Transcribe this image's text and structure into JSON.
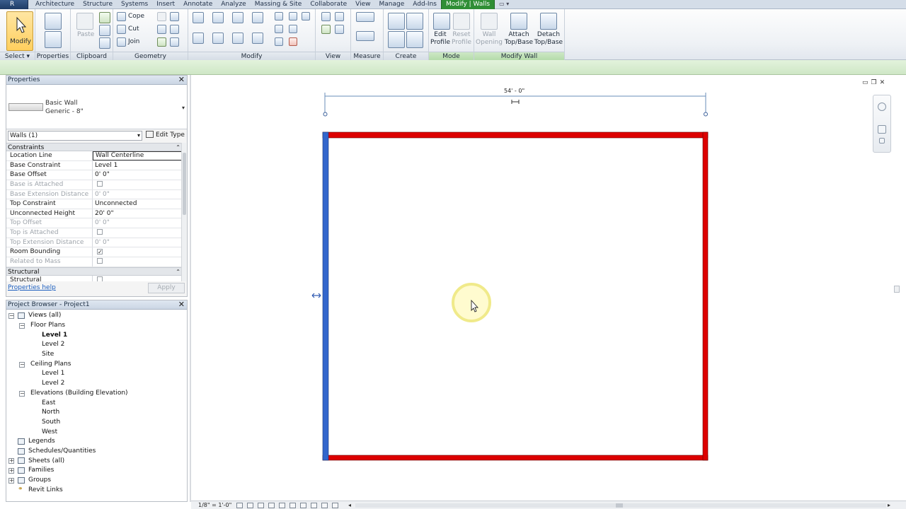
{
  "menu": {
    "app_button": "R",
    "tabs": [
      "Architecture",
      "Structure",
      "Systems",
      "Insert",
      "Annotate",
      "Analyze",
      "Massing & Site",
      "Collaborate",
      "View",
      "Manage",
      "Add-Ins",
      "Modify | Walls"
    ],
    "active_tab": "Modify | Walls",
    "extra": "▭ ▾"
  },
  "ribbon": {
    "select": {
      "button": "Modify",
      "label": "Select ▾"
    },
    "properties": {
      "label": "Properties"
    },
    "clipboard": {
      "paste": "Paste",
      "label": "Clipboard"
    },
    "geometry": {
      "cope": "Cope",
      "cut": "Cut",
      "join": "Join",
      "label": "Geometry"
    },
    "modify": {
      "label": "Modify"
    },
    "view": {
      "label": "View"
    },
    "measure": {
      "label": "Measure"
    },
    "create": {
      "label": "Create"
    },
    "mode": {
      "edit_profile_1": "Edit",
      "edit_profile_2": "Profile",
      "reset_profile_1": "Reset",
      "reset_profile_2": "Profile",
      "label": "Mode"
    },
    "modify_wall": {
      "wall_opening_1": "Wall",
      "wall_opening_2": "Opening",
      "attach_1": "Attach",
      "attach_2": "Top/Base",
      "detach_1": "Detach",
      "detach_2": "Top/Base",
      "label": "Modify Wall"
    }
  },
  "properties": {
    "title": "Properties",
    "type_family": "Basic Wall",
    "type_name": "Generic - 8\"",
    "filter": "Walls (1)",
    "edit_type": "Edit Type",
    "groups": {
      "constraints": "Constraints",
      "structural": "Structural"
    },
    "rows": {
      "location_line": {
        "name": "Location Line",
        "value": "Wall Centerline"
      },
      "base_constraint": {
        "name": "Base Constraint",
        "value": "Level 1"
      },
      "base_offset": {
        "name": "Base Offset",
        "value": "0'  0\""
      },
      "base_attached": {
        "name": "Base is Attached",
        "value": ""
      },
      "base_ext": {
        "name": "Base Extension Distance",
        "value": "0'  0\""
      },
      "top_constraint": {
        "name": "Top Constraint",
        "value": "Unconnected"
      },
      "unconn_height": {
        "name": "Unconnected Height",
        "value": "20'  0\""
      },
      "top_offset": {
        "name": "Top Offset",
        "value": "0'  0\""
      },
      "top_attached": {
        "name": "Top is Attached",
        "value": ""
      },
      "top_ext": {
        "name": "Top Extension Distance",
        "value": "0'  0\""
      },
      "room_bounding": {
        "name": "Room Bounding",
        "value": "✓"
      },
      "related_mass": {
        "name": "Related to Mass",
        "value": ""
      },
      "structural": {
        "name": "Structural",
        "value": ""
      }
    },
    "help": "Properties help",
    "apply": "Apply"
  },
  "browser": {
    "title": "Project Browser - Project1",
    "views_all": "Views (all)",
    "floor_plans": "Floor Plans",
    "fp_level1": "Level 1",
    "fp_level2": "Level 2",
    "fp_site": "Site",
    "ceiling_plans": "Ceiling Plans",
    "cp_level1": "Level 1",
    "cp_level2": "Level 2",
    "elevations": "Elevations (Building Elevation)",
    "east": "East",
    "north": "North",
    "south": "South",
    "west": "West",
    "legends": "Legends",
    "schedules": "Schedules/Quantities",
    "sheets": "Sheets (all)",
    "families": "Families",
    "groups": "Groups",
    "revit_links": "Revit Links"
  },
  "canvas": {
    "dimension": "54' - 0\"",
    "scale": "1/8\" = 1'-0\"",
    "colors": {
      "selected_wall": "#3366cc",
      "wall": "#dd0000",
      "highlight": "#fff7a8"
    }
  }
}
